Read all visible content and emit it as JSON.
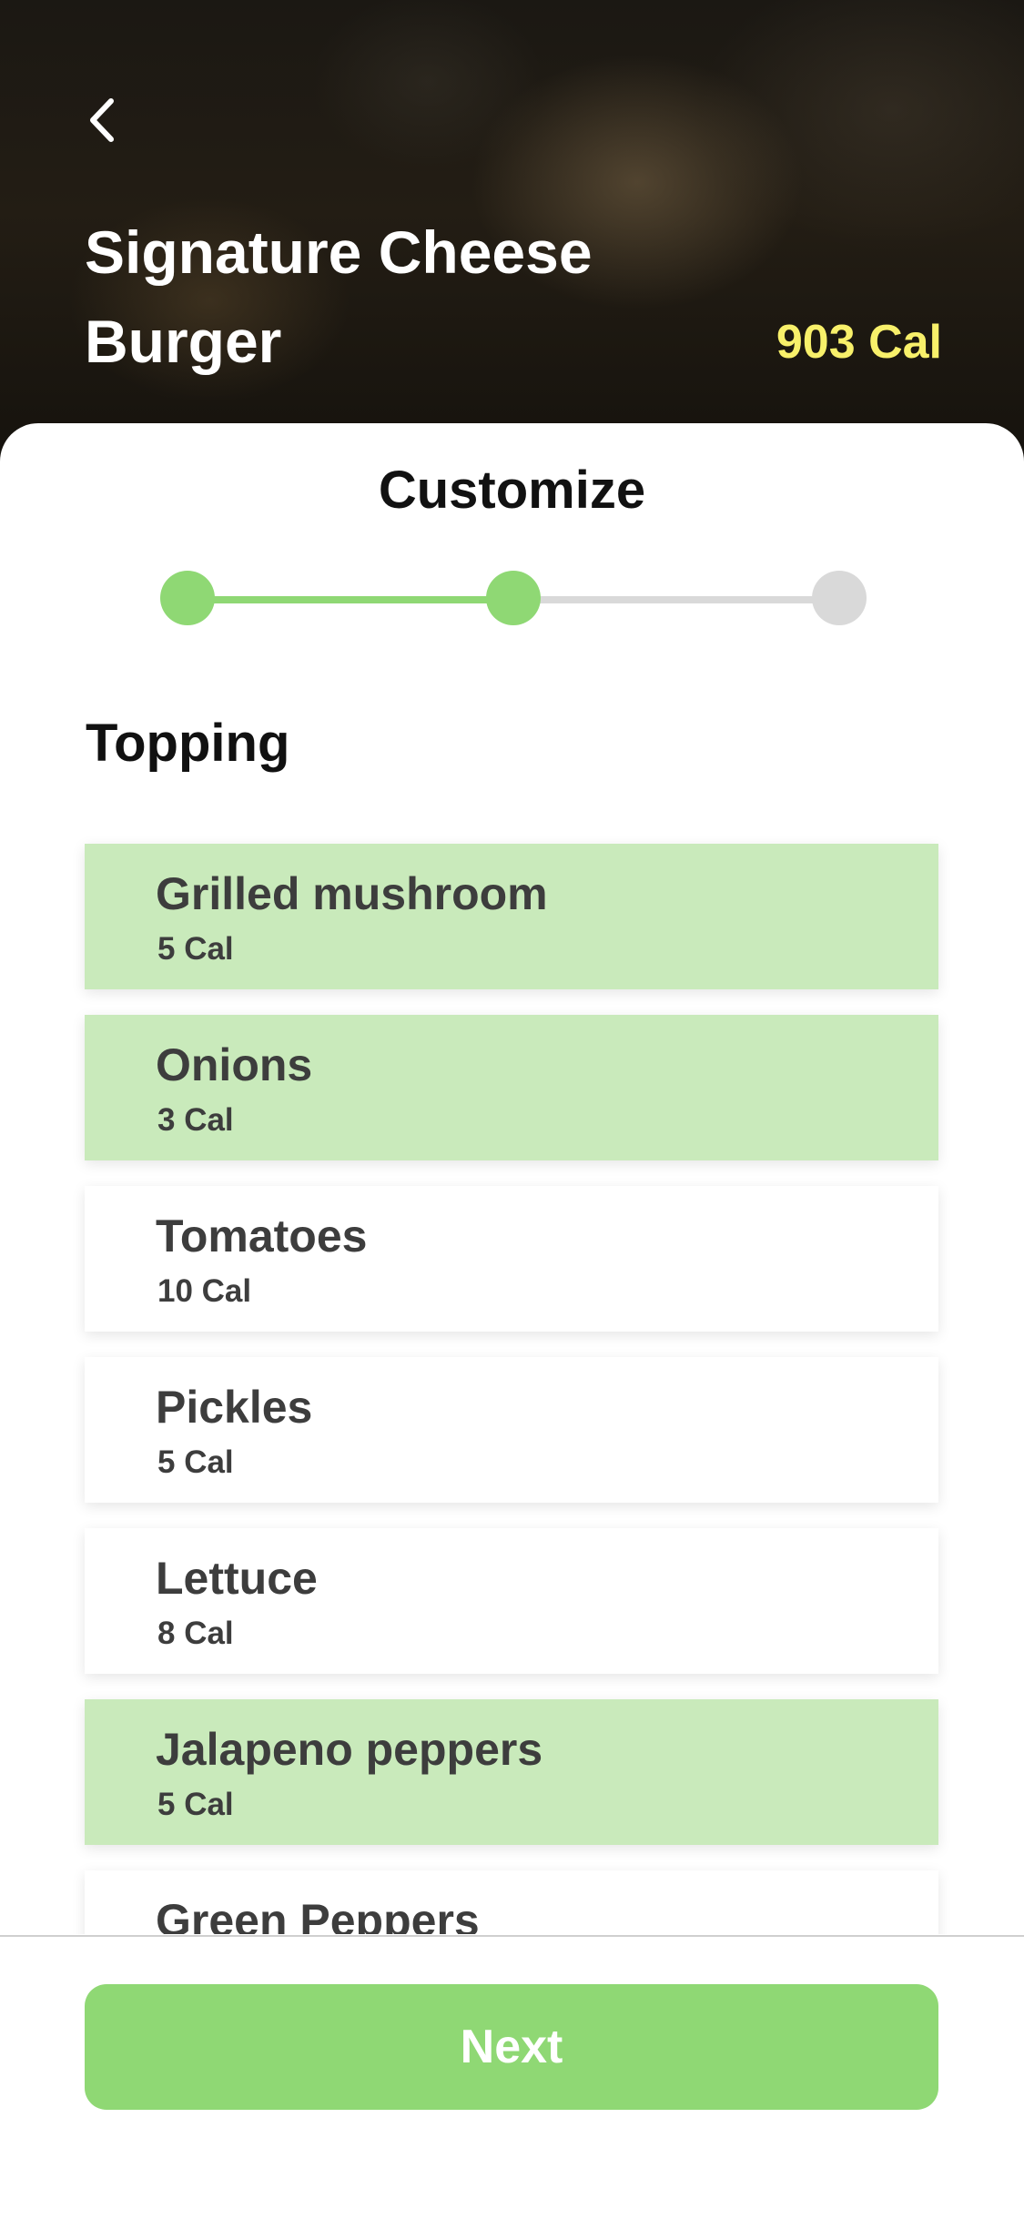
{
  "header": {
    "back_icon": "chevron-left-icon",
    "title": "Signature Cheese Burger",
    "calories": "903 Cal"
  },
  "customize": {
    "title": "Customize",
    "steps": [
      {
        "state": "complete",
        "color": "#8fd874"
      },
      {
        "state": "current",
        "color": "#8fd874"
      },
      {
        "state": "upcoming",
        "color": "#d9d9d9"
      }
    ]
  },
  "section": {
    "label": "Topping"
  },
  "toppings": [
    {
      "name": "Grilled mushroom",
      "calories": "5 Cal",
      "selected": true
    },
    {
      "name": "Onions",
      "calories": "3 Cal",
      "selected": true
    },
    {
      "name": "Tomatoes",
      "calories": "10 Cal",
      "selected": false
    },
    {
      "name": "Pickles",
      "calories": "5 Cal",
      "selected": false
    },
    {
      "name": "Lettuce",
      "calories": "8 Cal",
      "selected": false
    },
    {
      "name": "Jalapeno peppers",
      "calories": "5 Cal",
      "selected": true
    },
    {
      "name": "Green Peppers",
      "calories": "",
      "selected": false
    }
  ],
  "footer": {
    "next_label": "Next"
  },
  "colors": {
    "accent": "#8fd874",
    "selected_bg": "#c9eabb",
    "calorie_highlight": "#f8f06a",
    "inactive": "#d9d9d9"
  }
}
